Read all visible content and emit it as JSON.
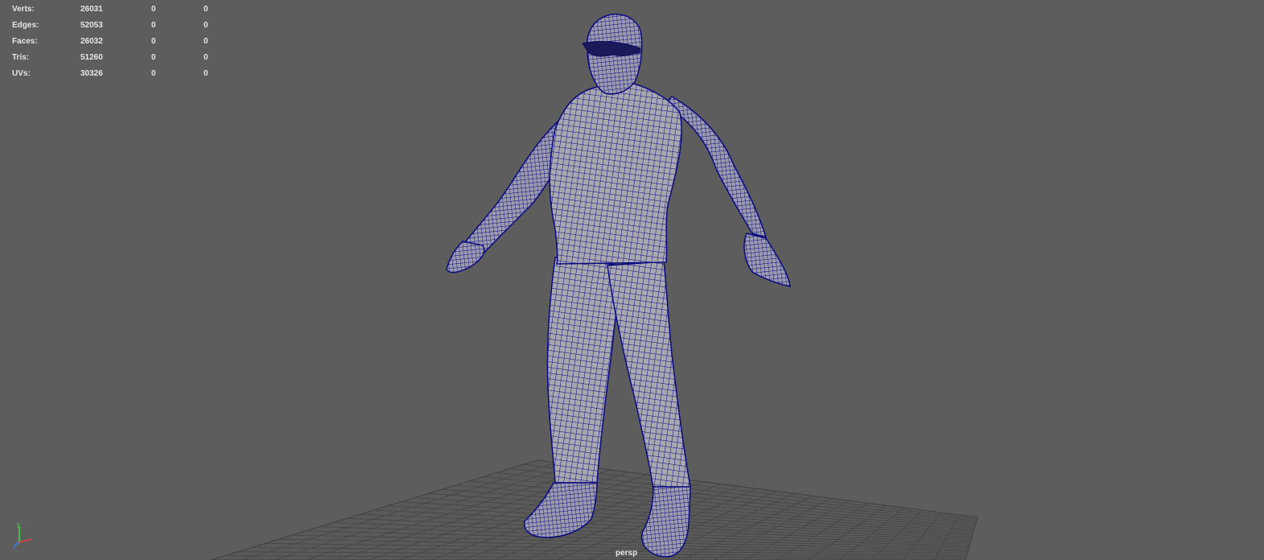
{
  "viewport": {
    "camera_label": "persp",
    "colors": {
      "background": "#5d5d5d",
      "grid": "#4a4a4a",
      "wireframe": "#0a0a80",
      "mesh_fill": "#a8a8b0",
      "hud_text": "#e6e6e6"
    }
  },
  "hud": {
    "rows": [
      {
        "label": "Verts:",
        "total": "26031",
        "selected": "0",
        "component": "0"
      },
      {
        "label": "Edges:",
        "total": "52053",
        "selected": "0",
        "component": "0"
      },
      {
        "label": "Faces:",
        "total": "26032",
        "selected": "0",
        "component": "0"
      },
      {
        "label": "Tris:",
        "total": "51260",
        "selected": "0",
        "component": "0"
      },
      {
        "label": "UVs:",
        "total": "30326",
        "selected": "0",
        "component": "0"
      }
    ]
  },
  "axis_gizmo": {
    "icon": "axis-gizmo-icon",
    "colors": {
      "x": "#e04040",
      "y": "#40e040",
      "z": "#4080ff"
    }
  }
}
